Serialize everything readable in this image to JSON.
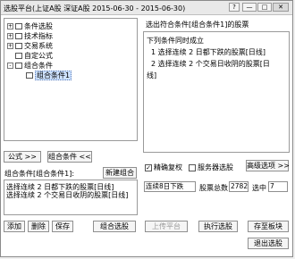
{
  "window": {
    "title": "选股平台(上证A股 深证A股  2015-06-30 - 2015-06-30)",
    "help_label": "?",
    "minimize_label": "—",
    "maximize_label": "□",
    "close_label": "✕"
  },
  "tree": {
    "items": [
      {
        "label": "条件选股",
        "expander": "+"
      },
      {
        "label": "技术指标",
        "expander": "+"
      },
      {
        "label": "交易系统",
        "expander": "+"
      },
      {
        "label": "自定公式",
        "expander": ""
      },
      {
        "label": "组合条件",
        "expander": "-"
      },
      {
        "label": "组合条件1",
        "expander": ""
      }
    ]
  },
  "right_panel": {
    "header": "选出符合条件[组合条件1]的股票",
    "line_intro": "下列条件同时成立",
    "line1": "1  选择连续 2 日都下跌的股票[日线]",
    "line2": "2  选择连续 2 个交易日收阴的股票[日",
    "line2_wrap": "线]"
  },
  "buttons": {
    "formula": "公式 >>",
    "combo": "组合条件 <<",
    "new_combo": "新建组合",
    "add": "添加",
    "delete": "删除",
    "save": "保存",
    "combo_select": "组合选股",
    "platform": "上传平台",
    "execute": "执行选股",
    "save_block": "存至板块",
    "exit": "退出选股",
    "advanced": "高级选项 >>"
  },
  "combo": {
    "label": "组合条件[组合条件1]:",
    "lines": [
      "选择连续 2 日都下跌的股票[日线]",
      "选择连续 2 个交易日收阴的股票[日线]"
    ]
  },
  "options": {
    "precise_fq": "精确复权",
    "server_select": "服务器选股"
  },
  "status": {
    "period": "连续8日下跌",
    "total_label": "股票总数",
    "total_value": "2782",
    "selected_label": "选中",
    "selected_value": "7"
  }
}
